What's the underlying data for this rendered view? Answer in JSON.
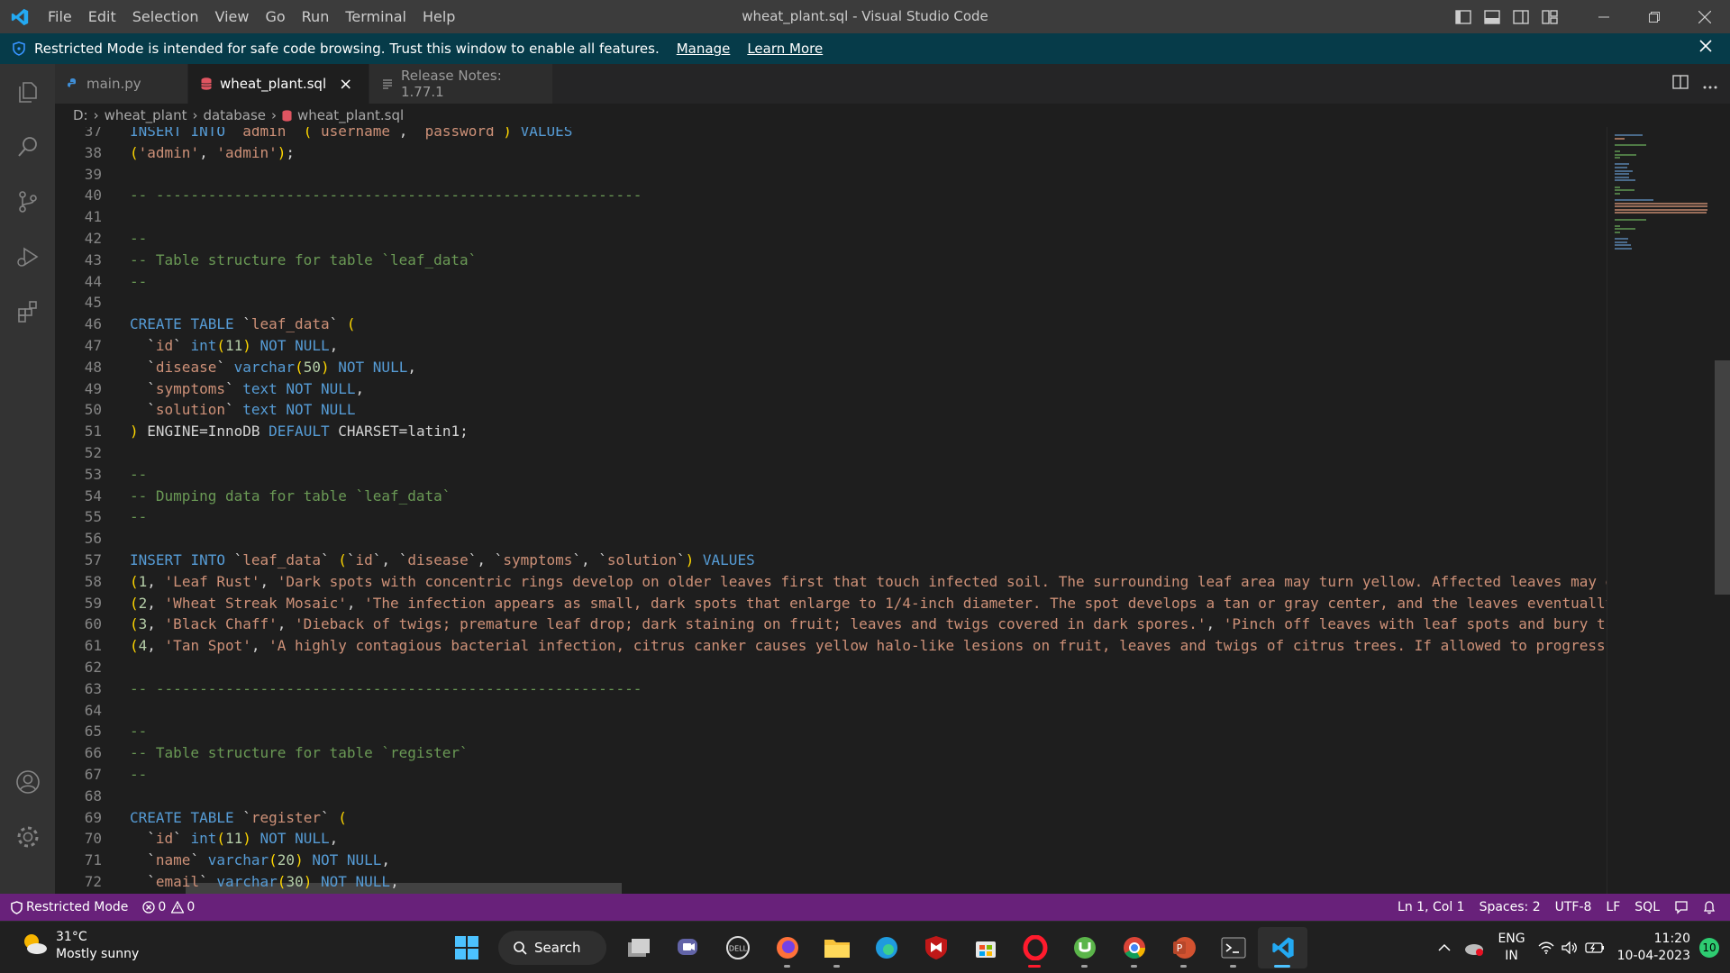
{
  "window": {
    "title": "wheat_plant.sql - Visual Studio Code",
    "menu": [
      "File",
      "Edit",
      "Selection",
      "View",
      "Go",
      "Run",
      "Terminal",
      "Help"
    ]
  },
  "banner": {
    "message": "Restricted Mode is intended for safe code browsing. Trust this window to enable all features.",
    "manage_label": "Manage",
    "learn_more_label": "Learn More"
  },
  "tabs": [
    {
      "label": "main.py",
      "icon": "python-file-icon",
      "active": false
    },
    {
      "label": "wheat_plant.sql",
      "icon": "database-file-icon",
      "active": true
    },
    {
      "label": "Release Notes: 1.77.1",
      "icon": "list-icon",
      "active": false
    }
  ],
  "breadcrumb": [
    "D:",
    "wheat_plant",
    "database",
    "wheat_plant.sql"
  ],
  "editor": {
    "lines": [
      {
        "n": "37",
        "t": "INSERT INTO `admin` (`username`, `password`) VALUES"
      },
      {
        "n": "38",
        "t": "('admin', 'admin');"
      },
      {
        "n": "39",
        "t": ""
      },
      {
        "n": "40",
        "t": "-- --------------------------------------------------------"
      },
      {
        "n": "41",
        "t": ""
      },
      {
        "n": "42",
        "t": "--"
      },
      {
        "n": "43",
        "t": "-- Table structure for table `leaf_data`"
      },
      {
        "n": "44",
        "t": "--"
      },
      {
        "n": "45",
        "t": ""
      },
      {
        "n": "46",
        "t": "CREATE TABLE `leaf_data` ("
      },
      {
        "n": "47",
        "t": "  `id` int(11) NOT NULL,"
      },
      {
        "n": "48",
        "t": "  `disease` varchar(50) NOT NULL,"
      },
      {
        "n": "49",
        "t": "  `symptoms` text NOT NULL,"
      },
      {
        "n": "50",
        "t": "  `solution` text NOT NULL"
      },
      {
        "n": "51",
        "t": ") ENGINE=InnoDB DEFAULT CHARSET=latin1;"
      },
      {
        "n": "52",
        "t": ""
      },
      {
        "n": "53",
        "t": "--"
      },
      {
        "n": "54",
        "t": "-- Dumping data for table `leaf_data`"
      },
      {
        "n": "55",
        "t": "--"
      },
      {
        "n": "56",
        "t": ""
      },
      {
        "n": "57",
        "t": "INSERT INTO `leaf_data` (`id`, `disease`, `symptoms`, `solution`) VALUES"
      },
      {
        "n": "58",
        "t": "(1, 'Leaf Rust', 'Dark spots with concentric rings develop on older leaves first that touch infected soil. The surrounding leaf area may turn yellow. Affected leaves may d"
      },
      {
        "n": "59",
        "t": "(2, 'Wheat Streak Mosaic', 'The infection appears as small, dark spots that enlarge to 1/4-inch diameter. The spot develops a tan or gray center, and the leaves eventually"
      },
      {
        "n": "60",
        "t": "(3, 'Black Chaff', 'Dieback of twigs; premature leaf drop; dark staining on fruit; leaves and twigs covered in dark spores.', 'Pinch off leaves with leaf spots and bury th"
      },
      {
        "n": "61",
        "t": "(4, 'Tan Spot', 'A highly contagious bacterial infection, citrus canker causes yellow halo-like lesions on fruit, leaves and twigs of citrus trees. If allowed to progress"
      },
      {
        "n": "62",
        "t": ""
      },
      {
        "n": "63",
        "t": "-- --------------------------------------------------------"
      },
      {
        "n": "64",
        "t": ""
      },
      {
        "n": "65",
        "t": "--"
      },
      {
        "n": "66",
        "t": "-- Table structure for table `register`"
      },
      {
        "n": "67",
        "t": "--"
      },
      {
        "n": "68",
        "t": ""
      },
      {
        "n": "69",
        "t": "CREATE TABLE `register` ("
      },
      {
        "n": "70",
        "t": "  `id` int(11) NOT NULL,"
      },
      {
        "n": "71",
        "t": "  `name` varchar(20) NOT NULL,"
      },
      {
        "n": "72",
        "t": "  `email` varchar(30) NOT NULL,"
      }
    ]
  },
  "statusbar": {
    "mode": "Restricted Mode",
    "errors": "0",
    "warnings": "0",
    "position": "Ln 1, Col 1",
    "spaces": "Spaces: 2",
    "encoding": "UTF-8",
    "eol": "LF",
    "language": "SQL"
  },
  "taskbar": {
    "temperature": "31°C",
    "weather": "Mostly sunny",
    "search_label": "Search",
    "lang_top": "ENG",
    "lang_bottom": "IN",
    "time": "11:20",
    "date": "10-04-2023",
    "notifications": "10"
  },
  "colors": {
    "titlebar": "#3c3c3c",
    "banner": "#063b49",
    "statusbar": "#68217a",
    "editor_bg": "#1e1e1e",
    "keyword": "#569cd6",
    "string": "#ce9178",
    "comment": "#6a9955",
    "number": "#b5cea8"
  }
}
